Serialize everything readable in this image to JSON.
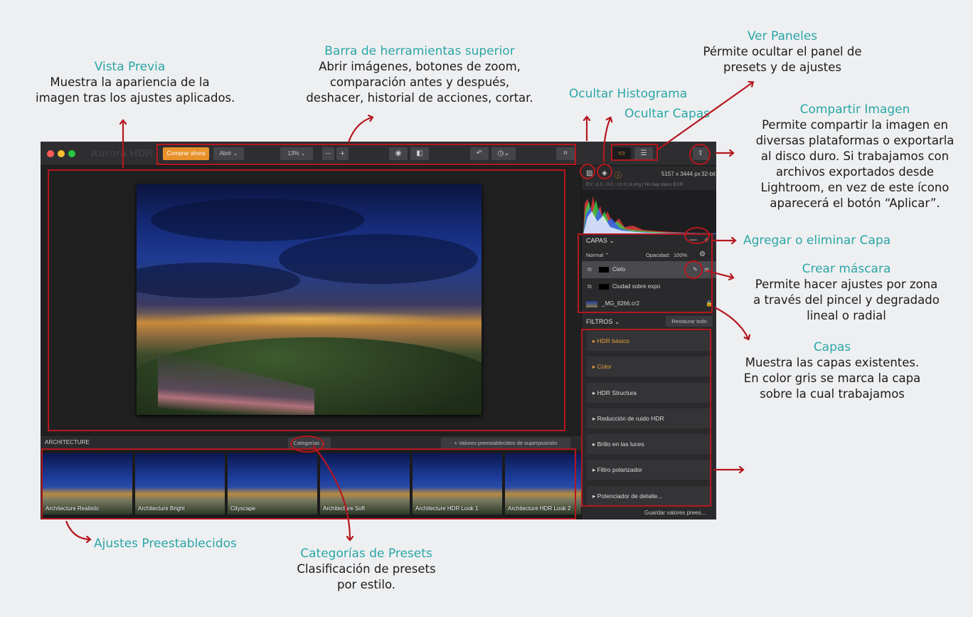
{
  "annotations": {
    "vista_previa": {
      "title": "Vista Previa",
      "lines": [
        "Muestra la apariencia de la",
        "imagen tras los ajustes aplicados."
      ]
    },
    "barra": {
      "title": "Barra de herramientas superior",
      "lines": [
        "Abrir imágenes, botones de zoom,",
        "comparación antes y después,",
        "deshacer, historial de acciones, cortar."
      ]
    },
    "ocultar_histograma": {
      "title": "Ocultar Histograma"
    },
    "ocultar_capas": {
      "title": "Ocultar Capas"
    },
    "ver_paneles": {
      "title": "Ver Paneles",
      "lines": [
        "Pérmite ocultar el panel de",
        "presets y de ajustes"
      ]
    },
    "compartir": {
      "title": "Compartir Imagen",
      "lines": [
        "Permite compartir la imagen en",
        "diversas plataformas o exportarla",
        "al disco duro. Si trabajamos con",
        "archivos exportados desde",
        "Lightroom, en vez de este ícono",
        "aparecerá el botón “Aplicar”."
      ]
    },
    "agregar_capa": {
      "title": "Agregar o eliminar Capa"
    },
    "crear_mascara": {
      "title": "Crear máscara",
      "lines": [
        "Permite hacer ajustes por zona",
        "a través del pincel y degradado",
        "lineal o radial"
      ]
    },
    "capas": {
      "title": "Capas",
      "lines": [
        "Muestra las capas existentes.",
        "En color gris se marca la capa",
        "sobre la cual trabajamos"
      ]
    },
    "ajustes": {
      "title": "Ajustes Preestablecidos"
    },
    "categorias": {
      "title": "Categorías de Presets",
      "lines": [
        "Clasificación de presets",
        "por estilo."
      ]
    }
  },
  "app": {
    "title": "Aurora HDR",
    "toolbar": {
      "buy": "Comprar ahora",
      "open": "Abrir ⌄",
      "zoom": "13%  ⌄",
      "minus": "—",
      "plus": "+"
    },
    "info": {
      "dims": "5157 x 3444 px",
      "bit": "32-bit",
      "exif": "EV: -1.0...0.0...+1.0  |  6 img  |  No hay datos EXIF"
    },
    "layers": {
      "header": "CAPAS ⌄",
      "blend": "Normal ⌃",
      "opacity_label": "Opacidad:",
      "opacity_value": "100%",
      "items": [
        "Cielo",
        "Ciudad sobre expo",
        "_MG_8266.cr2"
      ]
    },
    "filters": {
      "header": "FILTROS ⌄",
      "reset": "Restaurar todo",
      "items": [
        "HDR básico",
        "Color",
        "HDR Structura",
        "Reducción de ruido HDR",
        "Brillo en las luces",
        "Filtro polarizador",
        "Potenciador de detalle..."
      ],
      "save": "Guardar valores prees..."
    },
    "presets": {
      "category_label": "ARCHITECTURE",
      "categories_button": "Categorías ⌄",
      "overlay_button": "+ Valores preestablecidos de superposición",
      "items": [
        "Architecture Realistic",
        "Architecture Bright",
        "Cityscape",
        "Architecture Soft",
        "Architecture HDR Look 1",
        "Architecture HDR Look 2"
      ]
    }
  },
  "colors": {
    "accent_annotation": "#2ba6a6",
    "highlight_red": "#b5171f",
    "buy_button": "#e8912b"
  }
}
